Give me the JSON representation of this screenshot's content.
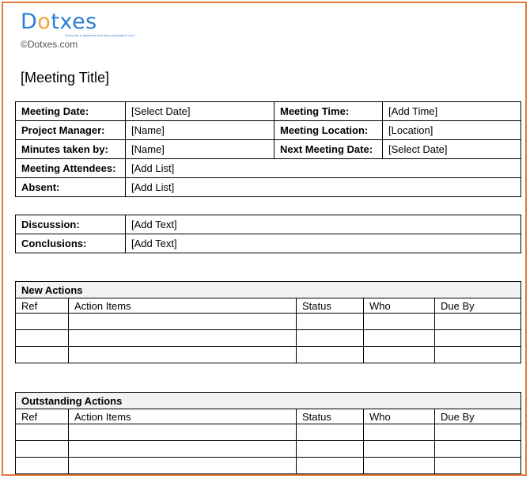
{
  "logo": {
    "text_d": "D",
    "text_o": "o",
    "text_rest": "txes",
    "tagline": "Every doc is awesome and every template is cool"
  },
  "copyright": "©Dotxes.com",
  "title": "[Meeting Title]",
  "info": {
    "meeting_date_label": "Meeting Date:",
    "meeting_date_value": "[Select Date]",
    "meeting_time_label": "Meeting Time:",
    "meeting_time_value": "[Add Time]",
    "pm_label": "Project Manager:",
    "pm_value": "[Name]",
    "location_label": "Meeting Location:",
    "location_value": "[Location]",
    "minutes_label": "Minutes taken by:",
    "minutes_value": "[Name]",
    "next_label": "Next Meeting Date:",
    "next_value": "[Select Date]",
    "attendees_label": "Meeting Attendees:",
    "attendees_value": "[Add List]",
    "absent_label": "Absent:",
    "absent_value": "[Add List]"
  },
  "discussion": {
    "discussion_label": "Discussion:",
    "discussion_value": "[Add Text]",
    "conclusions_label": "Conclusions:",
    "conclusions_value": "[Add Text]"
  },
  "new_actions": {
    "heading": "New Actions",
    "columns": [
      "Ref",
      "Action Items",
      "Status",
      "Who",
      "Due By"
    ]
  },
  "outstanding_actions": {
    "heading": "Outstanding Actions",
    "columns": [
      "Ref",
      "Action Items",
      "Status",
      "Who",
      "Due By"
    ]
  },
  "colors": {
    "page_border": "#e07b39",
    "logo_blue": "#2a7fd4",
    "logo_orange": "#f2a33a",
    "section_header_bg": "#f2f2f2"
  }
}
